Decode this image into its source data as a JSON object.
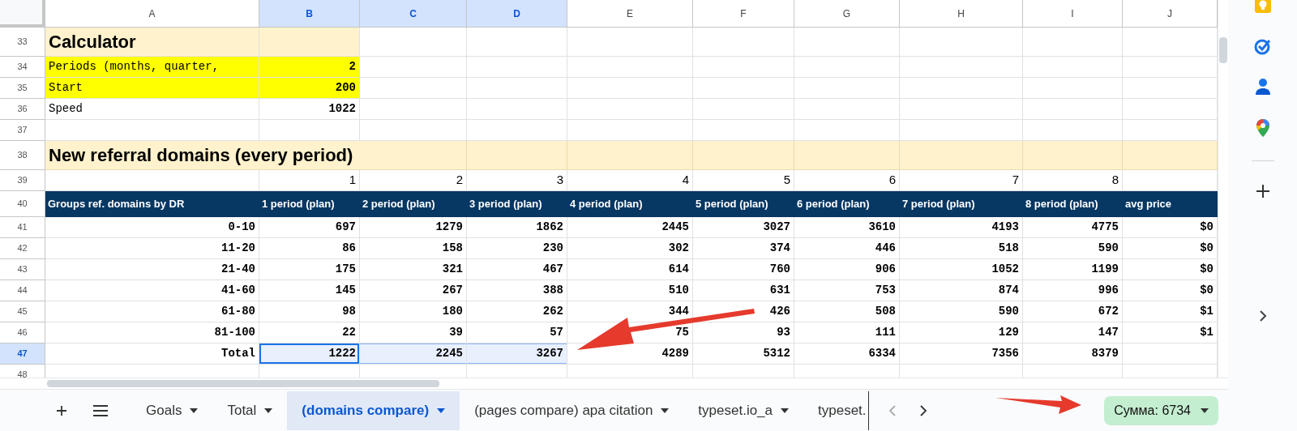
{
  "sheet": {
    "columns": [
      {
        "letter": "A",
        "selected": false
      },
      {
        "letter": "B",
        "selected": true
      },
      {
        "letter": "C",
        "selected": true
      },
      {
        "letter": "D",
        "selected": true
      },
      {
        "letter": "E",
        "selected": false
      },
      {
        "letter": "F",
        "selected": false
      },
      {
        "letter": "G",
        "selected": false
      },
      {
        "letter": "H",
        "selected": false
      },
      {
        "letter": "I",
        "selected": false
      },
      {
        "letter": "J",
        "selected": false
      }
    ],
    "rows": [
      {
        "number": "33",
        "kind": "title",
        "selected": false,
        "cells": [
          "Calculator"
        ]
      },
      {
        "number": "34",
        "kind": "input",
        "selected": false,
        "cells": [
          "Periods (months, quarter,",
          "2"
        ]
      },
      {
        "number": "35",
        "kind": "input",
        "selected": false,
        "cells": [
          "Start",
          "200"
        ]
      },
      {
        "number": "36",
        "kind": "plain",
        "selected": false,
        "cells": [
          "Speed",
          "1022"
        ]
      },
      {
        "number": "37",
        "kind": "plain",
        "selected": false,
        "cells": []
      },
      {
        "number": "38",
        "kind": "section",
        "selected": false,
        "cells": [
          "New referral domains (every period)"
        ]
      },
      {
        "number": "39",
        "kind": "index",
        "selected": false,
        "cells": [
          null,
          "1",
          "2",
          "3",
          "4",
          "5",
          "6",
          "7",
          "8"
        ]
      },
      {
        "number": "40",
        "kind": "header",
        "selected": false,
        "cells": [
          "Groups ref. domains by DR",
          "1 period (plan)",
          "2 period (plan)",
          "3 period (plan)",
          "4 period (plan)",
          "5 period (plan)",
          "6 period (plan)",
          "7 period (plan)",
          "8 period (plan)",
          "avg price"
        ]
      },
      {
        "number": "41",
        "kind": "data",
        "selected": false,
        "cells": [
          "0-10",
          "697",
          "1279",
          "1862",
          "2445",
          "3027",
          "3610",
          "4193",
          "4775",
          "$0"
        ]
      },
      {
        "number": "42",
        "kind": "data",
        "selected": false,
        "cells": [
          "11-20",
          "86",
          "158",
          "230",
          "302",
          "374",
          "446",
          "518",
          "590",
          "$0"
        ]
      },
      {
        "number": "43",
        "kind": "data",
        "selected": false,
        "cells": [
          "21-40",
          "175",
          "321",
          "467",
          "614",
          "760",
          "906",
          "1052",
          "1199",
          "$0"
        ]
      },
      {
        "number": "44",
        "kind": "data",
        "selected": false,
        "cells": [
          "41-60",
          "145",
          "267",
          "388",
          "510",
          "631",
          "753",
          "874",
          "996",
          "$0"
        ]
      },
      {
        "number": "45",
        "kind": "data",
        "selected": false,
        "cells": [
          "61-80",
          "98",
          "180",
          "262",
          "344",
          "426",
          "508",
          "590",
          "672",
          "$1"
        ]
      },
      {
        "number": "46",
        "kind": "data",
        "selected": false,
        "cells": [
          "81-100",
          "22",
          "39",
          "57",
          "75",
          "93",
          "111",
          "129",
          "147",
          "$1"
        ]
      },
      {
        "number": "47",
        "kind": "data",
        "selected": true,
        "cells": [
          "Total",
          "1222",
          "2245",
          "3267",
          "4289",
          "5312",
          "6334",
          "7356",
          "8379"
        ]
      },
      {
        "number": "48",
        "kind": "plain",
        "selected": false,
        "cells": []
      }
    ]
  },
  "sheet_tabs": [
    {
      "label": "Goals",
      "selected": false
    },
    {
      "label": "Total",
      "selected": false
    },
    {
      "label": "(domains compare)",
      "selected": true
    },
    {
      "label": "(pages compare) apa citation",
      "selected": false
    },
    {
      "label": "typeset.io_a",
      "selected": false
    },
    {
      "label": "typeset.",
      "selected": false
    }
  ],
  "sum": "Сумма: 6734"
}
